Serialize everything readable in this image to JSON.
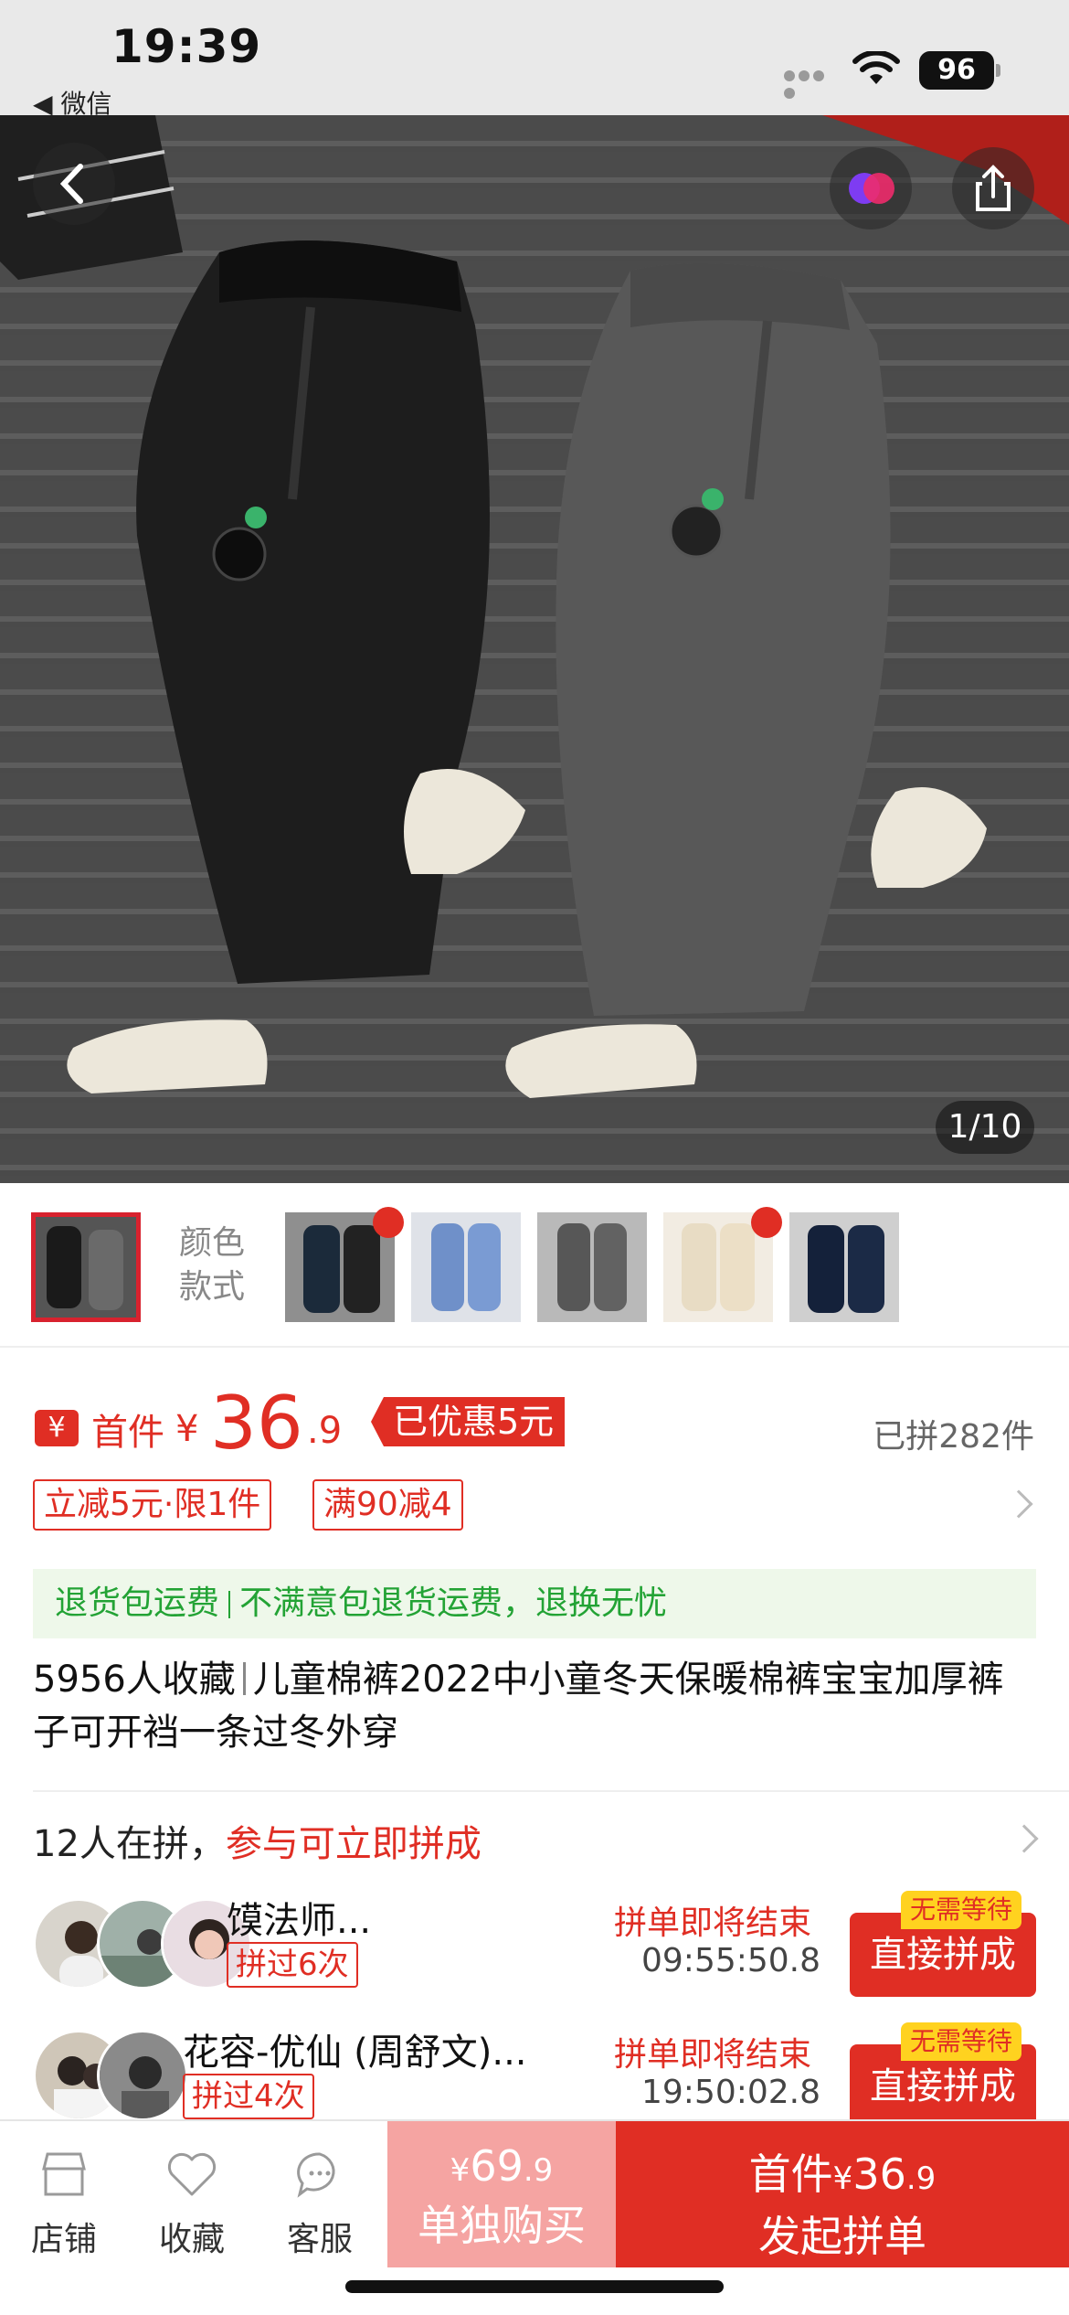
{
  "status_bar": {
    "time": "19:39",
    "back_app": "◀ 微信",
    "battery": "96"
  },
  "hero": {
    "counter": "1/10"
  },
  "thumbnails": {
    "label_line1": "颜色",
    "label_line2": "款式"
  },
  "price": {
    "first_label": "首件",
    "currency": "¥",
    "integer": "36",
    "decimal": ".9",
    "discount_badge": "已优惠5元",
    "sold": "已拼282件"
  },
  "coupons": [
    "立减5元·限1件",
    "满90减4"
  ],
  "returns": {
    "left": "退货包运费",
    "right": "不满意包退货运费，退换无忧"
  },
  "title": {
    "favorites": "5956人收藏",
    "text": "儿童棉裤2022中小童冬天保暖棉裤宝宝加厚裤子可开裆一条过冬外穿"
  },
  "group": {
    "count_text": "12人在拼，",
    "join_text": "参与可立即拼成",
    "rows": [
      {
        "name": "馍法师...",
        "times": "拼过6次",
        "ending": "拼单即将结束",
        "time": "09:55:50.8",
        "tag": "无需等待",
        "button": "直接拼成"
      },
      {
        "name": "花容-优仙 (周舒文)...",
        "times": "拼过4次",
        "ending": "拼单即将结束",
        "time": "19:50:02.8",
        "tag": "无需等待",
        "button": "直接拼成"
      }
    ]
  },
  "bottom_bar": {
    "store": "店铺",
    "favorite": "收藏",
    "service": "客服",
    "solo_price_yen": "¥",
    "solo_price": "69",
    "solo_price_dec": ".9",
    "solo_label": "单独购买",
    "group_price_prefix": "首件",
    "group_price_yen": "¥",
    "group_price": "36",
    "group_price_dec": ".9",
    "group_label": "发起拼单"
  },
  "colors": {
    "accent": "#e02e24",
    "green": "#23a335",
    "solo_bg": "#f5a4a2"
  },
  "icons": [
    "wifi-icon",
    "back-arrow-icon",
    "share-icon",
    "color-swatch-icon",
    "store-icon",
    "heart-icon",
    "chat-icon",
    "chevron-right-icon",
    "fire-icon"
  ]
}
